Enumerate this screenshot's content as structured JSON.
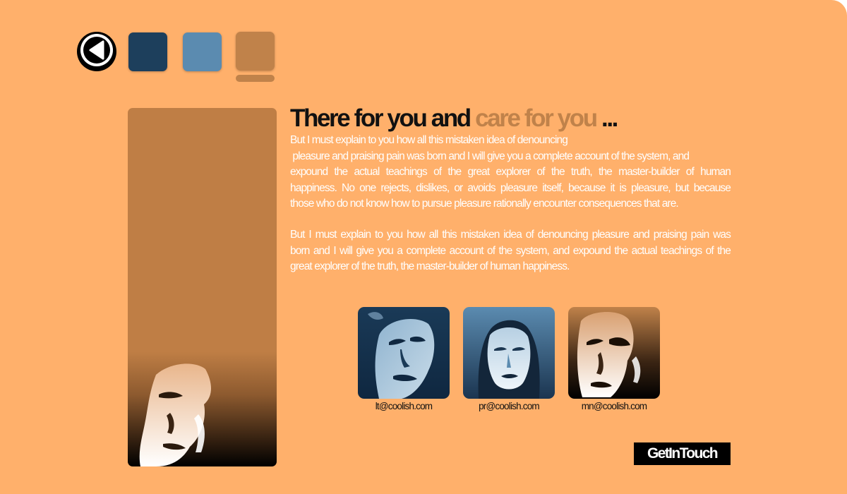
{
  "header": {
    "swatches": [
      {
        "name": "dark-blue",
        "color": "#1d3f5c"
      },
      {
        "name": "steel-blue",
        "color": "#5b8bb0"
      },
      {
        "name": "copper",
        "color": "#c0824a"
      }
    ]
  },
  "headline": {
    "part1": "There for you and ",
    "accent": "care for you",
    "part2": " ..."
  },
  "paragraph1": [
    "But I must explain to you how all this mistaken idea of denouncing",
    " pleasure and praising pain was born and I will give you a complete account of the system, and",
    "expound the actual teachings of the great explorer of the truth, the master-builder of human",
    "happiness. No one rejects, dislikes, or avoids pleasure itself, because it is pleasure, but because",
    "those who do not know how to pursue pleasure rationally encounter consequences that are."
  ],
  "paragraph2": [
    "But I must explain to you how all this mistaken idea of denouncing pleasure and praising pain was",
    "born and I will give you a complete account of the system, and expound the actual teachings of the",
    "great explorer of the truth, the master-builder of human happiness."
  ],
  "team": [
    {
      "email": "lt@coolish.com"
    },
    {
      "email": "pr@coolish.com"
    },
    {
      "email": "mn@coolish.com"
    }
  ],
  "cta": {
    "label": "GetInTouch"
  },
  "colors": {
    "background": "#ffb06b",
    "accent": "#c0824a",
    "dark_blue": "#1d3f5c",
    "steel_blue": "#5b8bb0"
  }
}
